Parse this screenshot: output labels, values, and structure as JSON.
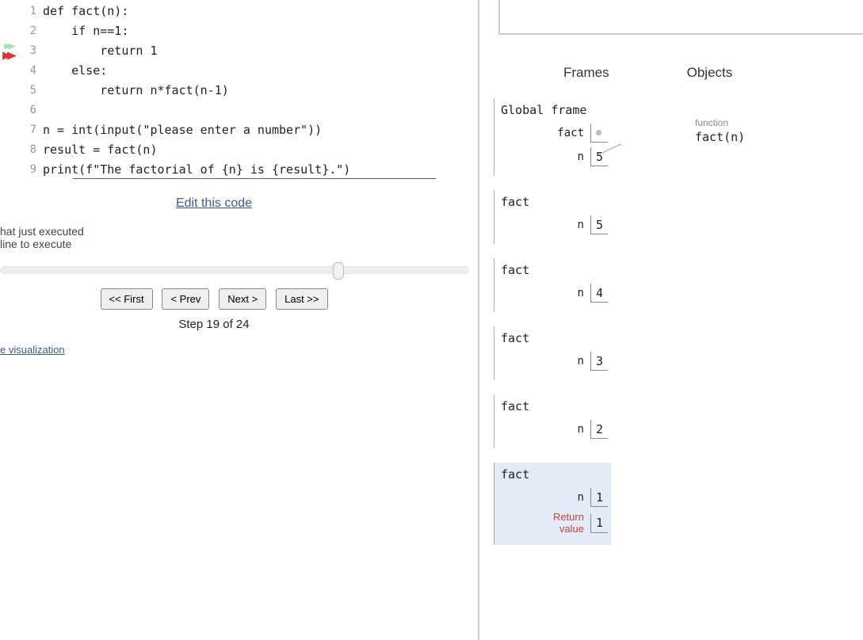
{
  "code": {
    "lines": [
      "def fact(n):",
      "    if n==1:",
      "        return 1",
      "    else:",
      "        return n*fact(n-1)",
      "",
      "n = int(input(\"please enter a number\"))",
      "result = fact(n)",
      "print(f\"The factorial of {n} is {result}.\")"
    ],
    "prev_arrow_line": 3,
    "next_arrow_line": 3
  },
  "edit_link": "Edit this code",
  "legend": {
    "prev": "hat just executed",
    "next": "line to execute"
  },
  "controls": {
    "first": "<< First",
    "prev": "< Prev",
    "next": "Next >",
    "last": "Last >>"
  },
  "step_label": "Step 19 of 24",
  "viz_link": "e visualization",
  "headers": {
    "frames": "Frames",
    "objects": "Objects"
  },
  "object": {
    "label": "function",
    "name": "fact(n)"
  },
  "frames": [
    {
      "title": "Global frame",
      "vars": [
        {
          "name": "fact",
          "val": "•ptr"
        },
        {
          "name": "n",
          "val": "5"
        }
      ],
      "active": false
    },
    {
      "title": "fact",
      "vars": [
        {
          "name": "n",
          "val": "5"
        }
      ],
      "active": false
    },
    {
      "title": "fact",
      "vars": [
        {
          "name": "n",
          "val": "4"
        }
      ],
      "active": false
    },
    {
      "title": "fact",
      "vars": [
        {
          "name": "n",
          "val": "3"
        }
      ],
      "active": false
    },
    {
      "title": "fact",
      "vars": [
        {
          "name": "n",
          "val": "2"
        }
      ],
      "active": false
    },
    {
      "title": "fact",
      "vars": [
        {
          "name": "n",
          "val": "1"
        },
        {
          "name": "Return\nvalue",
          "val": "1",
          "ret": true
        }
      ],
      "active": true
    }
  ]
}
